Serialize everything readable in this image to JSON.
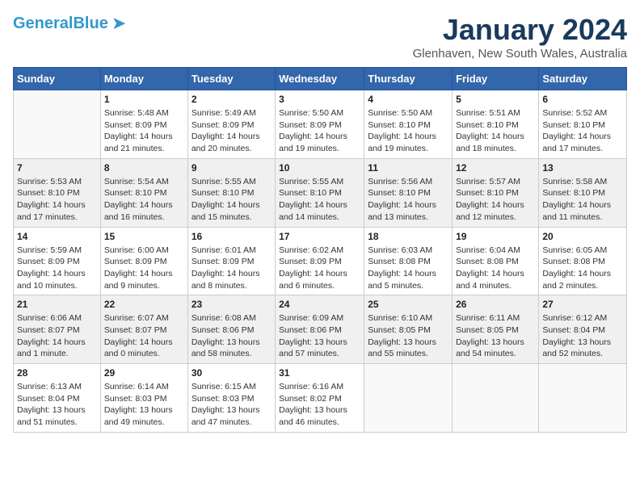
{
  "header": {
    "logo_general": "General",
    "logo_blue": "Blue",
    "month_year": "January 2024",
    "location": "Glenhaven, New South Wales, Australia"
  },
  "days_of_week": [
    "Sunday",
    "Monday",
    "Tuesday",
    "Wednesday",
    "Thursday",
    "Friday",
    "Saturday"
  ],
  "weeks": [
    [
      {
        "day": "",
        "info": ""
      },
      {
        "day": "1",
        "info": "Sunrise: 5:48 AM\nSunset: 8:09 PM\nDaylight: 14 hours\nand 21 minutes."
      },
      {
        "day": "2",
        "info": "Sunrise: 5:49 AM\nSunset: 8:09 PM\nDaylight: 14 hours\nand 20 minutes."
      },
      {
        "day": "3",
        "info": "Sunrise: 5:50 AM\nSunset: 8:09 PM\nDaylight: 14 hours\nand 19 minutes."
      },
      {
        "day": "4",
        "info": "Sunrise: 5:50 AM\nSunset: 8:10 PM\nDaylight: 14 hours\nand 19 minutes."
      },
      {
        "day": "5",
        "info": "Sunrise: 5:51 AM\nSunset: 8:10 PM\nDaylight: 14 hours\nand 18 minutes."
      },
      {
        "day": "6",
        "info": "Sunrise: 5:52 AM\nSunset: 8:10 PM\nDaylight: 14 hours\nand 17 minutes."
      }
    ],
    [
      {
        "day": "7",
        "info": "Sunrise: 5:53 AM\nSunset: 8:10 PM\nDaylight: 14 hours\nand 17 minutes."
      },
      {
        "day": "8",
        "info": "Sunrise: 5:54 AM\nSunset: 8:10 PM\nDaylight: 14 hours\nand 16 minutes."
      },
      {
        "day": "9",
        "info": "Sunrise: 5:55 AM\nSunset: 8:10 PM\nDaylight: 14 hours\nand 15 minutes."
      },
      {
        "day": "10",
        "info": "Sunrise: 5:55 AM\nSunset: 8:10 PM\nDaylight: 14 hours\nand 14 minutes."
      },
      {
        "day": "11",
        "info": "Sunrise: 5:56 AM\nSunset: 8:10 PM\nDaylight: 14 hours\nand 13 minutes."
      },
      {
        "day": "12",
        "info": "Sunrise: 5:57 AM\nSunset: 8:10 PM\nDaylight: 14 hours\nand 12 minutes."
      },
      {
        "day": "13",
        "info": "Sunrise: 5:58 AM\nSunset: 8:10 PM\nDaylight: 14 hours\nand 11 minutes."
      }
    ],
    [
      {
        "day": "14",
        "info": "Sunrise: 5:59 AM\nSunset: 8:09 PM\nDaylight: 14 hours\nand 10 minutes."
      },
      {
        "day": "15",
        "info": "Sunrise: 6:00 AM\nSunset: 8:09 PM\nDaylight: 14 hours\nand 9 minutes."
      },
      {
        "day": "16",
        "info": "Sunrise: 6:01 AM\nSunset: 8:09 PM\nDaylight: 14 hours\nand 8 minutes."
      },
      {
        "day": "17",
        "info": "Sunrise: 6:02 AM\nSunset: 8:09 PM\nDaylight: 14 hours\nand 6 minutes."
      },
      {
        "day": "18",
        "info": "Sunrise: 6:03 AM\nSunset: 8:08 PM\nDaylight: 14 hours\nand 5 minutes."
      },
      {
        "day": "19",
        "info": "Sunrise: 6:04 AM\nSunset: 8:08 PM\nDaylight: 14 hours\nand 4 minutes."
      },
      {
        "day": "20",
        "info": "Sunrise: 6:05 AM\nSunset: 8:08 PM\nDaylight: 14 hours\nand 2 minutes."
      }
    ],
    [
      {
        "day": "21",
        "info": "Sunrise: 6:06 AM\nSunset: 8:07 PM\nDaylight: 14 hours\nand 1 minute."
      },
      {
        "day": "22",
        "info": "Sunrise: 6:07 AM\nSunset: 8:07 PM\nDaylight: 14 hours\nand 0 minutes."
      },
      {
        "day": "23",
        "info": "Sunrise: 6:08 AM\nSunset: 8:06 PM\nDaylight: 13 hours\nand 58 minutes."
      },
      {
        "day": "24",
        "info": "Sunrise: 6:09 AM\nSunset: 8:06 PM\nDaylight: 13 hours\nand 57 minutes."
      },
      {
        "day": "25",
        "info": "Sunrise: 6:10 AM\nSunset: 8:05 PM\nDaylight: 13 hours\nand 55 minutes."
      },
      {
        "day": "26",
        "info": "Sunrise: 6:11 AM\nSunset: 8:05 PM\nDaylight: 13 hours\nand 54 minutes."
      },
      {
        "day": "27",
        "info": "Sunrise: 6:12 AM\nSunset: 8:04 PM\nDaylight: 13 hours\nand 52 minutes."
      }
    ],
    [
      {
        "day": "28",
        "info": "Sunrise: 6:13 AM\nSunset: 8:04 PM\nDaylight: 13 hours\nand 51 minutes."
      },
      {
        "day": "29",
        "info": "Sunrise: 6:14 AM\nSunset: 8:03 PM\nDaylight: 13 hours\nand 49 minutes."
      },
      {
        "day": "30",
        "info": "Sunrise: 6:15 AM\nSunset: 8:03 PM\nDaylight: 13 hours\nand 47 minutes."
      },
      {
        "day": "31",
        "info": "Sunrise: 6:16 AM\nSunset: 8:02 PM\nDaylight: 13 hours\nand 46 minutes."
      },
      {
        "day": "",
        "info": ""
      },
      {
        "day": "",
        "info": ""
      },
      {
        "day": "",
        "info": ""
      }
    ]
  ]
}
